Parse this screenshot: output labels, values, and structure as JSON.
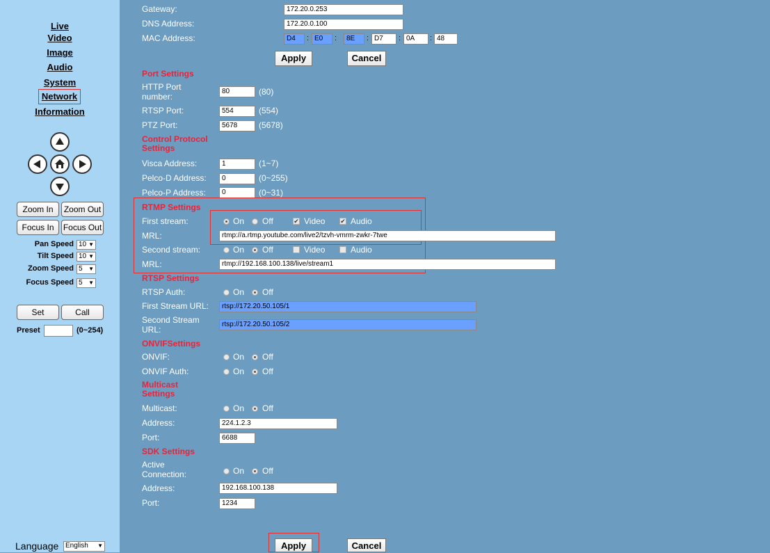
{
  "sidebar": {
    "nav": [
      {
        "label": "Live"
      },
      {
        "label": "Video"
      },
      {
        "label": "Image"
      },
      {
        "label": "Audio"
      },
      {
        "label": "System"
      },
      {
        "label": "Network"
      },
      {
        "label": "Information"
      }
    ],
    "zoom_in": "Zoom In",
    "zoom_out": "Zoom Out",
    "focus_in": "Focus In",
    "focus_out": "Focus Out",
    "pan_speed_label": "Pan Speed",
    "pan_speed": "10",
    "tilt_speed_label": "Tilt Speed",
    "tilt_speed": "10",
    "zoom_speed_label": "Zoom Speed",
    "zoom_speed": "5",
    "focus_speed_label": "Focus Speed",
    "focus_speed": "5",
    "set": "Set",
    "call": "Call",
    "preset_label": "Preset",
    "preset_value": "",
    "preset_range": "(0~254)",
    "language_label": "Language",
    "language": "English"
  },
  "network": {
    "gateway_label": "Gateway:",
    "gateway": "172.20.0.253",
    "dns_label": "DNS Address:",
    "dns": "172.20.0.100",
    "mac_label": "MAC Address:",
    "mac": [
      "D4",
      "E0",
      "8E",
      "D7",
      "0A",
      "48"
    ],
    "apply": "Apply",
    "cancel": "Cancel"
  },
  "port": {
    "title": "Port Settings",
    "http_label": "HTTP Port number:",
    "http": "80",
    "http_hint": "(80)",
    "rtsp_label": "RTSP Port:",
    "rtsp": "554",
    "rtsp_hint": "(554)",
    "ptz_label": "PTZ Port:",
    "ptz": "5678",
    "ptz_hint": "(5678)"
  },
  "control": {
    "title": "Control Protocol Settings",
    "visca_label": "Visca Address:",
    "visca": "1",
    "visca_hint": "(1~7)",
    "pelcod_label": "Pelco-D Address:",
    "pelcod": "0",
    "pelcod_hint": "(0~255)",
    "pelcop_label": "Pelco-P Address:",
    "pelcop": "0",
    "pelcop_hint": "(0~31)"
  },
  "rtmp": {
    "title": "RTMP Settings",
    "first_label": "First stream:",
    "on": "On",
    "off": "Off",
    "video": "Video",
    "audio": "Audio",
    "mrl_label": "MRL:",
    "mrl1": "rtmp://a.rtmp.youtube.com/live2/tzvh-vmrm-zwkr-7twe",
    "second_label": "Second stream:",
    "mrl2": "rtmp://192.168.100.138/live/stream1"
  },
  "rtsp": {
    "title": "RTSP Settings",
    "auth_label": "RTSP Auth:",
    "first_url_label": "First Stream URL:",
    "first_url": "rtsp://172.20.50.105/1",
    "second_url_label": "Second Stream URL:",
    "second_url": "rtsp://172.20.50.105/2"
  },
  "onvif": {
    "title": "ONVIFSettings",
    "onvif_label": "ONVIF:",
    "auth_label": "ONVIF Auth:"
  },
  "multicast": {
    "title": "Multicast Settings",
    "multicast_label": "Multicast:",
    "address_label": "Address:",
    "address": "224.1.2.3",
    "port_label": "Port:",
    "port": "6688"
  },
  "sdk": {
    "title": "SDK Settings",
    "active_label": "Active Connection:",
    "address_label": "Address:",
    "address": "192.168.100.138",
    "port_label": "Port:",
    "port": "1234"
  },
  "footer": {
    "apply": "Apply",
    "cancel": "Cancel"
  },
  "colors": {
    "sidebar": "#a9d5f5",
    "main": "#6c9cc0",
    "section": "#e8243a",
    "highlight": "#6aa0ff"
  }
}
